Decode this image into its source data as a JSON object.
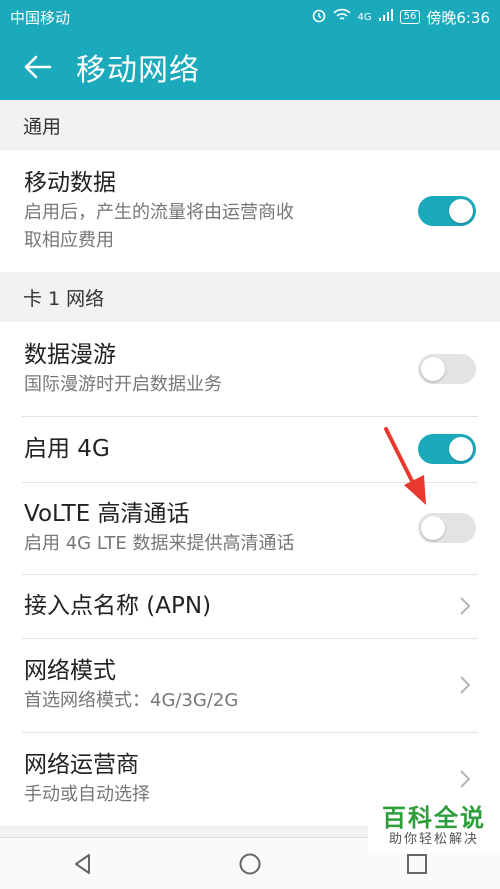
{
  "status_bar": {
    "carrier": "中国移动",
    "network": "4G",
    "battery": "56",
    "time": "傍晚6:36"
  },
  "header": {
    "title": "移动网络",
    "back_icon": "arrow-left-icon"
  },
  "sections": {
    "general": {
      "header": "通用",
      "mobile_data": {
        "title": "移动数据",
        "subtitle_line1": "启用后，产生的流量将由运营商收",
        "subtitle_line2": "取相应费用",
        "enabled": true
      }
    },
    "card1": {
      "header": "卡 1 网络",
      "roaming": {
        "title": "数据漫游",
        "subtitle": "国际漫游时开启数据业务",
        "enabled": false
      },
      "enable_4g": {
        "title": "启用 4G",
        "enabled": true
      },
      "volte": {
        "title": "VoLTE 高清通话",
        "subtitle": "启用 4G LTE 数据来提供高清通话",
        "enabled": false
      },
      "apn": {
        "title": "接入点名称 (APN)"
      },
      "network_mode": {
        "title": "网络模式",
        "subtitle": "首选网络模式：4G/3G/2G"
      },
      "carrier": {
        "title": "网络运营商",
        "subtitle": "手动或自动选择"
      }
    }
  },
  "watermark": {
    "main": "百科全说",
    "sub": "助你轻松解决"
  },
  "colors": {
    "accent": "#1ba9bc",
    "toggle_off": "#e3e3e3",
    "annotation_arrow": "#e8382f",
    "watermark_green": "#2e9e3c"
  }
}
